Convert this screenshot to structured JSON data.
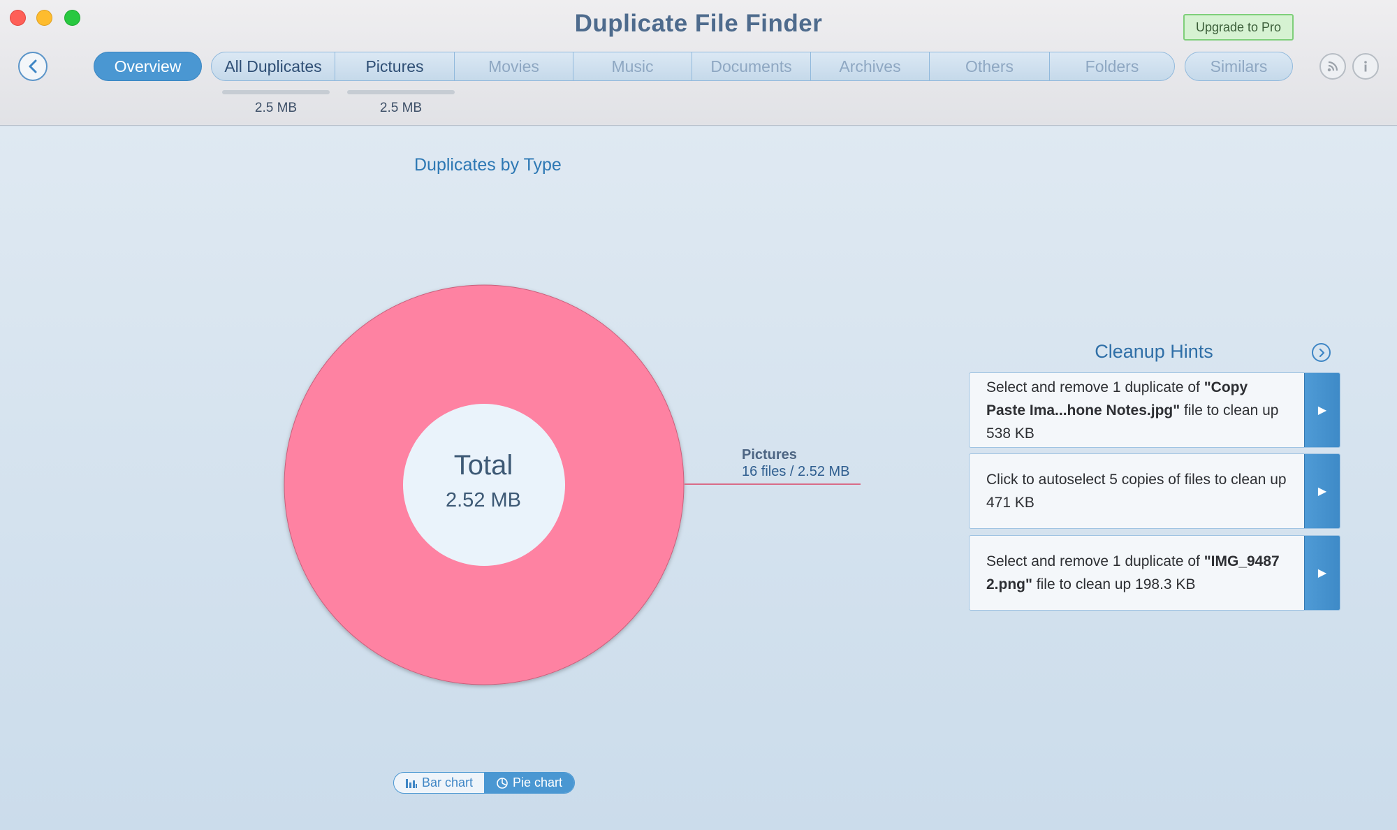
{
  "window": {
    "title": "Duplicate File Finder",
    "upgrade_label": "Upgrade to Pro"
  },
  "toolbar": {
    "back_icon": "chevron-left-icon",
    "overview_label": "Overview",
    "tabs": [
      {
        "label": "All Duplicates",
        "size": "2.5 MB",
        "active": true
      },
      {
        "label": "Pictures",
        "size": "2.5 MB",
        "active": true
      },
      {
        "label": "Movies",
        "active": false
      },
      {
        "label": "Music",
        "active": false
      },
      {
        "label": "Documents",
        "active": false
      },
      {
        "label": "Archives",
        "active": false
      },
      {
        "label": "Others",
        "active": false
      },
      {
        "label": "Folders",
        "active": false
      }
    ],
    "similars_label": "Similars",
    "rss_icon": "rss-icon",
    "info_icon": "info-icon"
  },
  "main": {
    "section_title": "Duplicates by Type",
    "total_label": "Total",
    "total_value": "2.52 MB"
  },
  "chart_data": {
    "type": "pie",
    "title": "Duplicates by Type",
    "slices": [
      {
        "name": "Pictures",
        "detail": "16 files / 2.52 MB",
        "value": 2.52,
        "color": "#fe82a2"
      }
    ],
    "center_label": "Total",
    "center_value": "2.52 MB"
  },
  "hints": {
    "title": "Cleanup Hints",
    "items": [
      {
        "pre": "Select and remove 1 duplicate of ",
        "bold": "\"Copy Paste Ima...hone Notes.jpg\"",
        "post": " file to clean up 538 KB"
      },
      {
        "pre": "Click to autoselect 5 copies of files to clean up 471 KB",
        "bold": "",
        "post": ""
      },
      {
        "pre": "Select and remove 1 duplicate of ",
        "bold": "\"IMG_9487 2.png\"",
        "post": " file to clean up 198.3 KB"
      }
    ]
  },
  "chart_toggle": {
    "bar_label": "Bar chart",
    "pie_label": "Pie chart",
    "selected": "Pie chart"
  },
  "colors": {
    "accent": "#4a97d2",
    "pie_pictures": "#fe82a2",
    "title": "#4e6b8d"
  }
}
